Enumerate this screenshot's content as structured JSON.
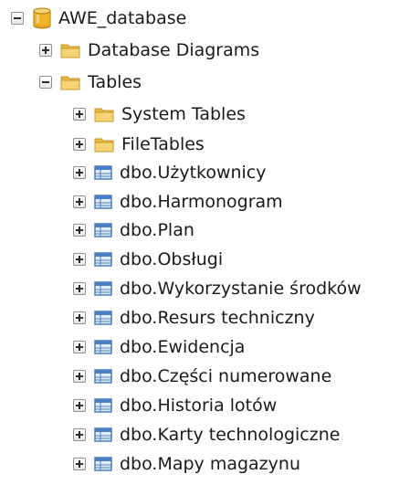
{
  "tree": {
    "database": {
      "label": "AWE_database",
      "icon": "database-cylinder-icon",
      "state": "expanded"
    },
    "database_diagrams": {
      "label": "Database Diagrams",
      "icon": "folder-icon",
      "state": "collapsed"
    },
    "tables": {
      "label": "Tables",
      "icon": "folder-icon",
      "state": "expanded",
      "folders": [
        {
          "label": "System Tables",
          "icon": "folder-icon",
          "state": "collapsed"
        },
        {
          "label": "FileTables",
          "icon": "folder-icon",
          "state": "collapsed"
        }
      ],
      "items": [
        {
          "label": "dbo.Użytkownicy",
          "icon": "table-icon",
          "state": "collapsed"
        },
        {
          "label": "dbo.Harmonogram",
          "icon": "table-icon",
          "state": "collapsed"
        },
        {
          "label": "dbo.Plan",
          "icon": "table-icon",
          "state": "collapsed"
        },
        {
          "label": "dbo.Obsługi",
          "icon": "table-icon",
          "state": "collapsed"
        },
        {
          "label": "dbo.Wykorzystanie środków",
          "icon": "table-icon",
          "state": "collapsed"
        },
        {
          "label": "dbo.Resurs techniczny",
          "icon": "table-icon",
          "state": "collapsed"
        },
        {
          "label": "dbo.Ewidencja",
          "icon": "table-icon",
          "state": "collapsed"
        },
        {
          "label": "dbo.Części numerowane",
          "icon": "table-icon",
          "state": "collapsed"
        },
        {
          "label": "dbo.Historia lotów",
          "icon": "table-icon",
          "state": "collapsed"
        },
        {
          "label": "dbo.Karty technologiczne",
          "icon": "table-icon",
          "state": "collapsed"
        },
        {
          "label": "dbo.Mapy magazynu",
          "icon": "table-icon",
          "state": "collapsed"
        }
      ]
    }
  },
  "colors": {
    "folder": "#f2c94c",
    "folder_edge": "#c9972a",
    "database": "#f0b429",
    "table_blue": "#4a7fc4",
    "table_fill": "#e3edf9"
  }
}
